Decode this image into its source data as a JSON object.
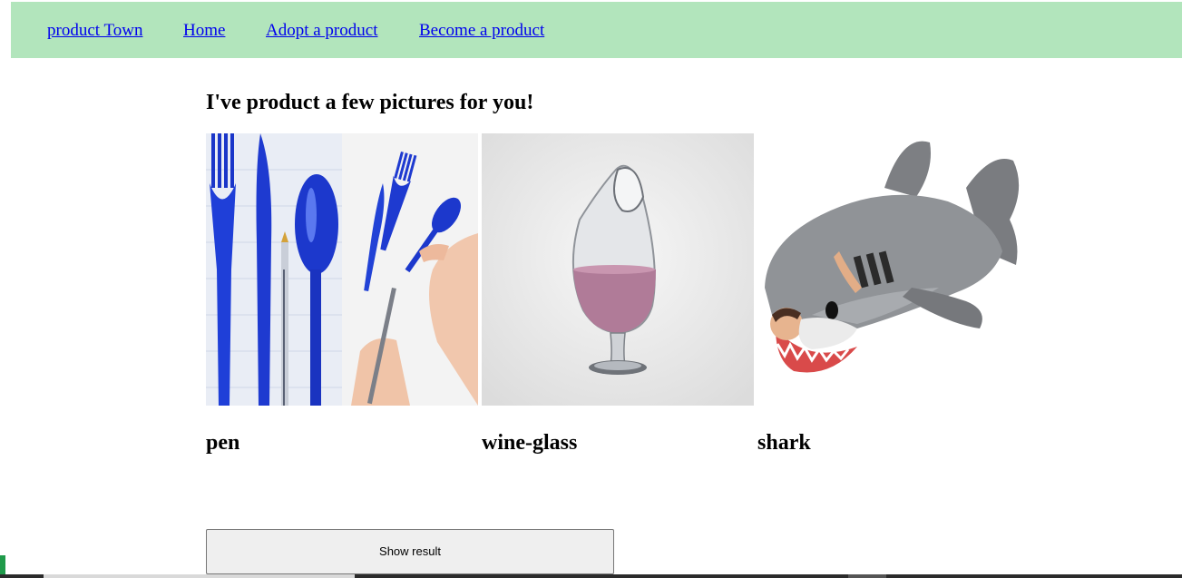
{
  "nav": {
    "brand": "product Town",
    "links": [
      "Home",
      "Adopt a product",
      "Become a product"
    ]
  },
  "main": {
    "heading": "I've product a few pictures for you!",
    "items": [
      {
        "caption": "pen",
        "image": "pen-photo"
      },
      {
        "caption": "wine-glass",
        "image": "wine-glass-photo"
      },
      {
        "caption": "shark",
        "image": "shark-photo"
      }
    ],
    "button_label": "Show result"
  },
  "colors": {
    "nav_bg": "#b2e5bc",
    "link": "#0000ee",
    "button_bg": "#efefef"
  }
}
